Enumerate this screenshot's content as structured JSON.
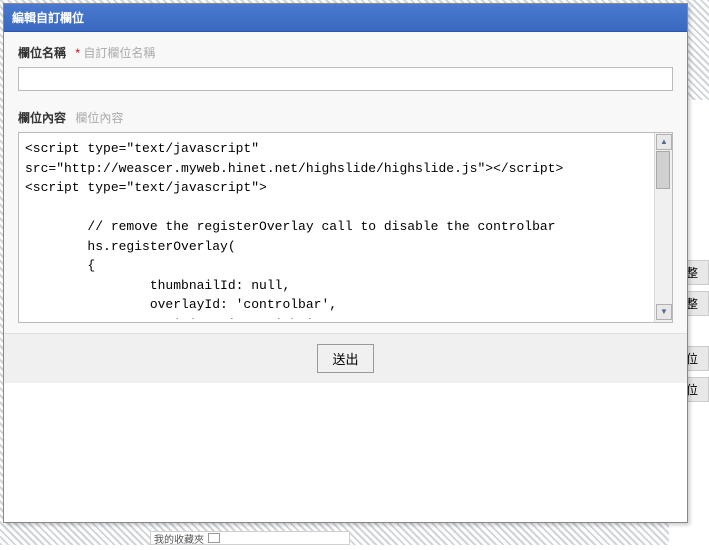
{
  "modal": {
    "title": "編輯自訂欄位",
    "field_name": {
      "label": "欄位名稱",
      "required_marker": "*",
      "hint": "自訂欄位名稱",
      "value": ""
    },
    "field_content": {
      "label": "欄位內容",
      "hint": "欄位內容",
      "value": "<script type=\"text/javascript\"\nsrc=\"http://weascer.myweb.hinet.net/highslide/highslide.js\"></script>\n<script type=\"text/javascript\">\n\n        // remove the registerOverlay call to disable the controlbar\n        hs.registerOverlay(\n        {\n                thumbnailId: null,\n                overlayId: 'controlbar',\n                position: 'top right',\n                hideOnMouseOut: true\n                }"
    },
    "submit_label": "送出"
  },
  "background": {
    "side_item_1": "彙整",
    "side_item_2": "彙整",
    "side_item_3": "欄位",
    "side_item_4": "欄位",
    "bottom_text": "我的收藏夾"
  }
}
